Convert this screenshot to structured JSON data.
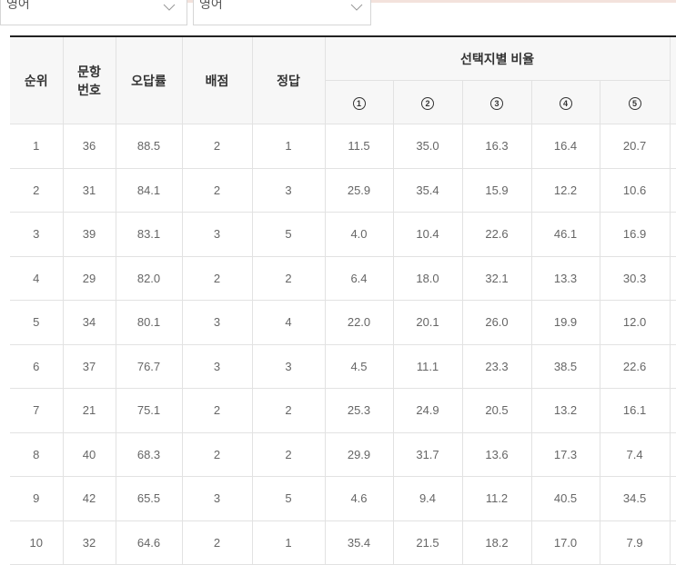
{
  "filters": {
    "left_value": "영어",
    "right_value": "영어"
  },
  "table": {
    "headers": {
      "rank": "순위",
      "question_no_line1": "문항",
      "question_no_line2": "번호",
      "error_rate": "오답률",
      "points": "배점",
      "answer": "정답",
      "choice_ratio": "선택지별 비율",
      "choices": [
        "1",
        "2",
        "3",
        "4",
        "5"
      ]
    },
    "rows": [
      {
        "rank": "1",
        "q": "36",
        "err": "88.5",
        "pts": "2",
        "ans": "1",
        "c": [
          "11.5",
          "35.0",
          "16.3",
          "16.4",
          "20.7"
        ]
      },
      {
        "rank": "2",
        "q": "31",
        "err": "84.1",
        "pts": "2",
        "ans": "3",
        "c": [
          "25.9",
          "35.4",
          "15.9",
          "12.2",
          "10.6"
        ]
      },
      {
        "rank": "3",
        "q": "39",
        "err": "83.1",
        "pts": "3",
        "ans": "5",
        "c": [
          "4.0",
          "10.4",
          "22.6",
          "46.1",
          "16.9"
        ]
      },
      {
        "rank": "4",
        "q": "29",
        "err": "82.0",
        "pts": "2",
        "ans": "2",
        "c": [
          "6.4",
          "18.0",
          "32.1",
          "13.3",
          "30.3"
        ]
      },
      {
        "rank": "5",
        "q": "34",
        "err": "80.1",
        "pts": "3",
        "ans": "4",
        "c": [
          "22.0",
          "20.1",
          "26.0",
          "19.9",
          "12.0"
        ]
      },
      {
        "rank": "6",
        "q": "37",
        "err": "76.7",
        "pts": "3",
        "ans": "3",
        "c": [
          "4.5",
          "11.1",
          "23.3",
          "38.5",
          "22.6"
        ]
      },
      {
        "rank": "7",
        "q": "21",
        "err": "75.1",
        "pts": "2",
        "ans": "2",
        "c": [
          "25.3",
          "24.9",
          "20.5",
          "13.2",
          "16.1"
        ]
      },
      {
        "rank": "8",
        "q": "40",
        "err": "68.3",
        "pts": "2",
        "ans": "2",
        "c": [
          "29.9",
          "31.7",
          "13.6",
          "17.3",
          "7.4"
        ]
      },
      {
        "rank": "9",
        "q": "42",
        "err": "65.5",
        "pts": "3",
        "ans": "5",
        "c": [
          "4.6",
          "9.4",
          "11.2",
          "40.5",
          "34.5"
        ]
      },
      {
        "rank": "10",
        "q": "32",
        "err": "64.6",
        "pts": "2",
        "ans": "1",
        "c": [
          "35.4",
          "21.5",
          "18.2",
          "17.0",
          "7.9"
        ]
      }
    ]
  }
}
